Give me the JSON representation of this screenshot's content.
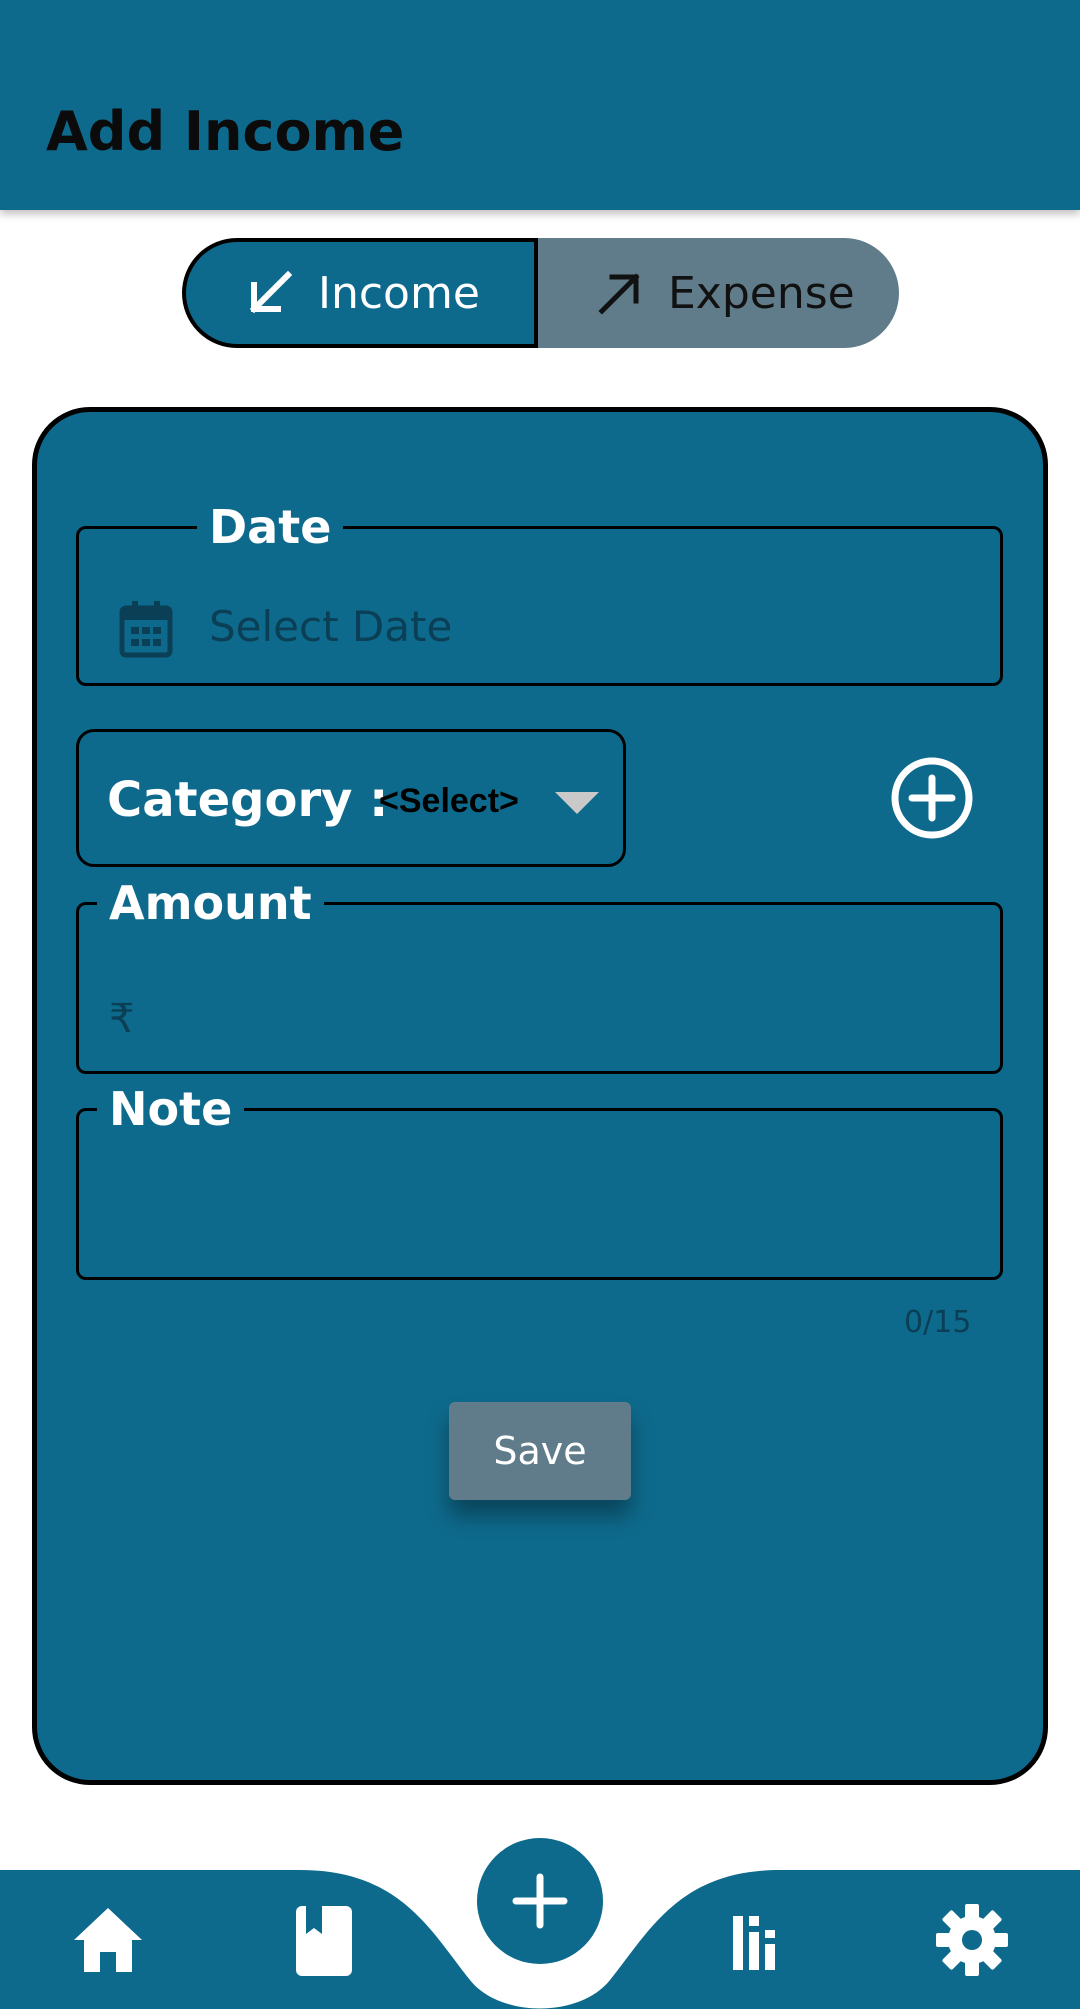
{
  "appbar": {
    "title": "Add Income"
  },
  "toggle": {
    "income_label": "Income",
    "expense_label": "Expense",
    "selected": "Income"
  },
  "form": {
    "date": {
      "label": "Date",
      "placeholder": "Select Date"
    },
    "category": {
      "label": "Category :",
      "value": "<Select>"
    },
    "amount": {
      "label": "Amount",
      "currency_symbol": "₹",
      "value": ""
    },
    "note": {
      "label": "Note",
      "value": "",
      "counter": "0/15"
    },
    "save_label": "Save"
  },
  "bottom_nav": {
    "items": [
      {
        "icon": "home-icon"
      },
      {
        "icon": "book-icon"
      },
      {
        "icon": "plus-icon"
      },
      {
        "icon": "bar-chart-icon"
      },
      {
        "icon": "gear-icon"
      }
    ]
  },
  "colors": {
    "primary": "#0e6a8c",
    "secondary": "#607c8a",
    "text_dark": "#0b0b0b",
    "on_primary": "#ffffff"
  }
}
